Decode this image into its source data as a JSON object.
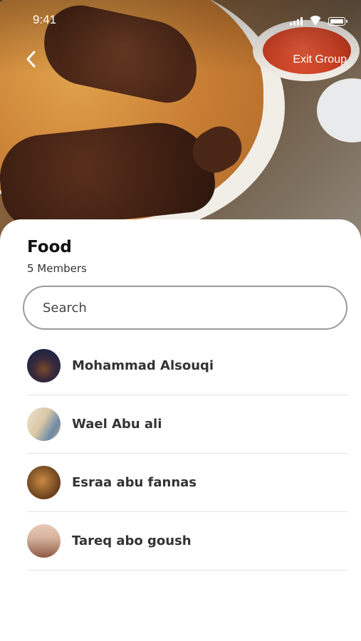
{
  "status_bar": {
    "time": "9:41"
  },
  "header": {
    "exit_label": "Exit Group"
  },
  "group": {
    "title": "Food",
    "members_count": "5 Members"
  },
  "search": {
    "placeholder": "Search"
  },
  "members": [
    {
      "name": "Mohammad Alsouqi",
      "avatar_colors": [
        "#1a2447",
        "#7a4a2a"
      ]
    },
    {
      "name": "Wael Abu ali",
      "avatar_colors": [
        "#d9c7a6",
        "#6c8aa8"
      ]
    },
    {
      "name": "Esraa abu fannas",
      "avatar_colors": [
        "#5a3416",
        "#c98a45"
      ]
    },
    {
      "name": "Tareq abo goush",
      "avatar_colors": [
        "#d7b4a0",
        "#8e5a44"
      ]
    }
  ],
  "icons": {
    "back": "chevron-left-icon"
  },
  "colors": {
    "search_border": "#9a9a9a",
    "divider": "#e2e2e2",
    "title": "#111111"
  }
}
